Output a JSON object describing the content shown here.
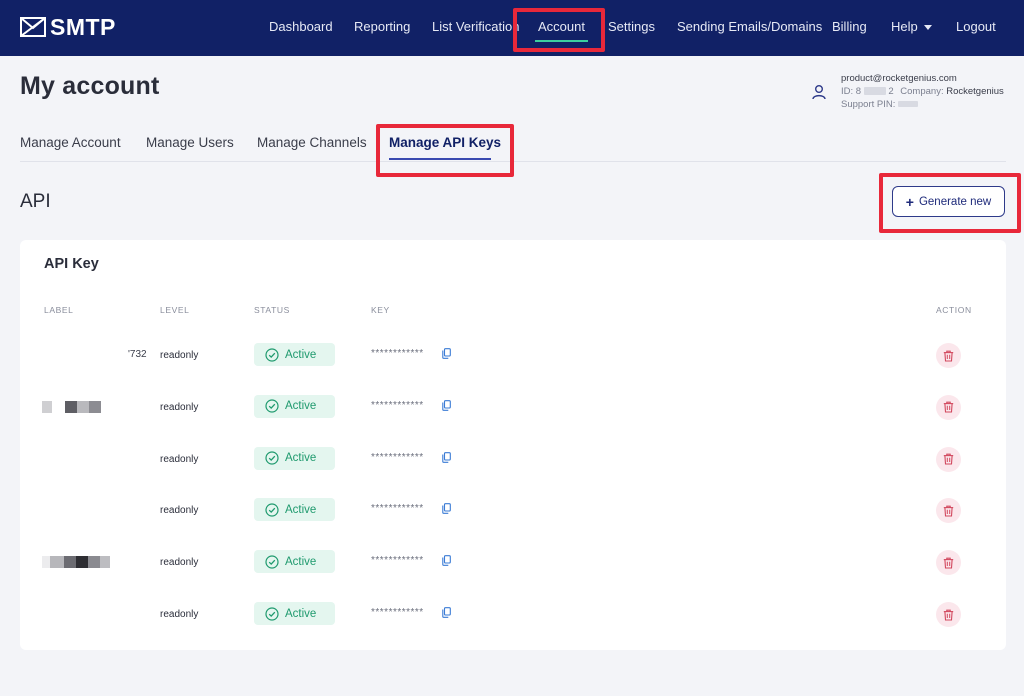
{
  "app": {
    "logo_text": "SMTP"
  },
  "nav": {
    "dashboard": "Dashboard",
    "reporting": "Reporting",
    "list_verification": "List Verification",
    "account": "Account",
    "settings": "Settings",
    "sending": "Sending Emails/Domains",
    "billing": "Billing",
    "help": "Help",
    "logout": "Logout"
  },
  "page": {
    "title": "My account"
  },
  "user": {
    "email": "product@rocketgenius.com",
    "id_label": "ID: 8",
    "id_suffix": "2",
    "company_label": "Company:",
    "company": "Rocketgenius",
    "pin_label": "Support PIN:"
  },
  "tabs": {
    "manage_account": "Manage Account",
    "manage_users": "Manage Users",
    "manage_channels": "Manage Channels",
    "manage_api_keys": "Manage API Keys"
  },
  "section": {
    "title": "API",
    "generate_label": "Generate new"
  },
  "card": {
    "title": "API Key",
    "columns": {
      "label": "LABEL",
      "level": "LEVEL",
      "status": "STATUS",
      "key": "KEY",
      "action": "ACTION"
    },
    "rows": [
      {
        "label": "'732",
        "level": "readonly",
        "status": "Active",
        "key": "************"
      },
      {
        "label": "",
        "level": "readonly",
        "status": "Active",
        "key": "************"
      },
      {
        "label": "",
        "level": "readonly",
        "status": "Active",
        "key": "************"
      },
      {
        "label": "",
        "level": "readonly",
        "status": "Active",
        "key": "************"
      },
      {
        "label": "",
        "level": "readonly",
        "status": "Active",
        "key": "************"
      },
      {
        "label": "",
        "level": "readonly",
        "status": "Active",
        "key": "************"
      }
    ]
  },
  "colors": {
    "nav_bg": "#112166",
    "accent_green": "#1f9a6e",
    "highlight_red": "#e8283a",
    "trash_red": "#d2485e"
  },
  "icons": {
    "logo": "envelope-icon",
    "user": "user-icon",
    "check": "check-circle-icon",
    "copy": "copy-icon",
    "delete": "trash-icon",
    "plus": "plus-icon"
  }
}
